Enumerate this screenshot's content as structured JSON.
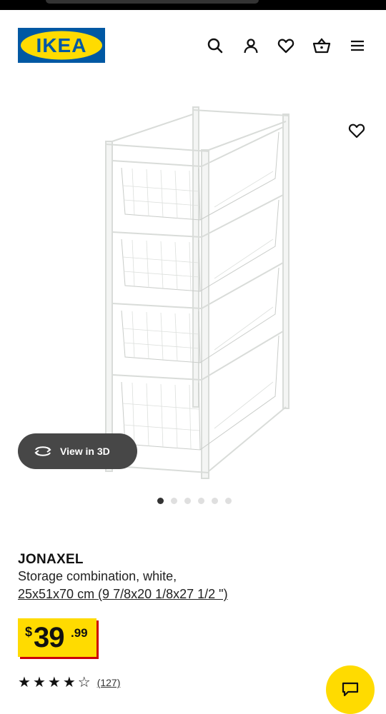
{
  "brand": {
    "logo_text": "IKEA",
    "blue": "#0058a3",
    "yellow": "#ffdb00"
  },
  "header": {
    "icons": [
      "search-icon",
      "account-icon",
      "favorites-heart-icon",
      "shopping-cart-icon",
      "menu-icon"
    ]
  },
  "gallery": {
    "view3d_label": "View in 3D",
    "image_count": 6,
    "active_index": 0
  },
  "product": {
    "name": "JONAXEL",
    "description": "Storage combination, white,",
    "dimensions": "25x51x70 cm (9 7/8x20 1/8x27 1/2 \")"
  },
  "price": {
    "currency": "$",
    "integer": "39",
    "decimal": ".99"
  },
  "rating": {
    "count_text": "(127)"
  },
  "colors": {
    "price_shadow": "#cc0008",
    "view3d_bg": "#474747"
  }
}
